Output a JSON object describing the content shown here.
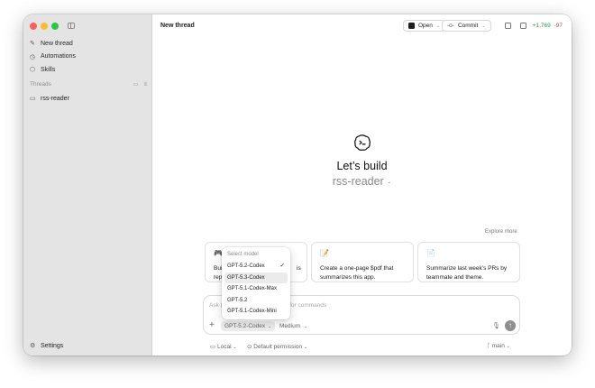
{
  "window": {
    "traffic_colors": [
      "#fe5f57",
      "#febc2e",
      "#28c840"
    ]
  },
  "sidebar": {
    "nav": [
      {
        "icon": "edit-icon",
        "label": "New thread"
      },
      {
        "icon": "clock-icon",
        "label": "Automations"
      },
      {
        "icon": "skills-icon",
        "label": "Skills"
      }
    ],
    "threads_header": "Threads",
    "threads": [
      {
        "icon": "folder-icon",
        "label": "rss-reader"
      }
    ],
    "settings_label": "Settings"
  },
  "topbar": {
    "title": "New thread",
    "open_label": "Open",
    "commit_label": "Commit",
    "diff_added": "+1,769",
    "diff_removed": "-97",
    "diff_added_color": "#2f9a4b",
    "diff_removed_color": "#d0453a"
  },
  "hero": {
    "title": "Let’s build",
    "project": "rss-reader"
  },
  "suggestions": {
    "explore_label": "Explore more",
    "cards": [
      {
        "icon": "game-controller-icon",
        "text_left": "Buil",
        "text_left2": "repc",
        "text_right": "is"
      },
      {
        "icon": "pencil-icon",
        "text": "Create a one-page $pdf that summarizes this app."
      },
      {
        "icon": "document-icon",
        "text": "Summarize last week’s PRs by teammate and theme."
      }
    ]
  },
  "composer": {
    "placeholder_left": "Ask (",
    "placeholder_right": "s, / for commands",
    "model": "GPT-5.2-Codex",
    "effort": "Medium"
  },
  "statusbar": {
    "env": "Local",
    "permission": "Default permission",
    "branch": "main"
  },
  "model_menu": {
    "header": "Select model",
    "items": [
      "GPT-5.2-Codex",
      "GPT-5.3-Codex",
      "GPT-5.1-Codex-Max",
      "GPT-5.2",
      "GPT-5.1-Codex-Mini"
    ],
    "selected": "GPT-5.2-Codex",
    "highlighted": "GPT-5.3-Codex"
  }
}
